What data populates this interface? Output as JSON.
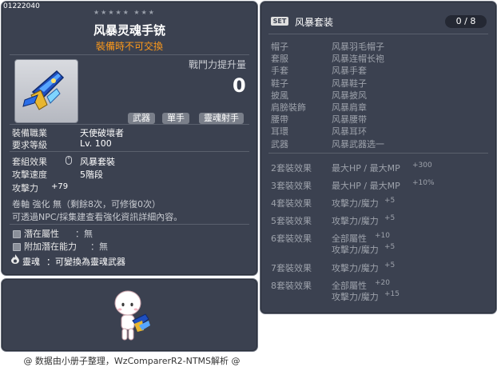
{
  "item": {
    "serial": "01222040",
    "stars_row": "★★★★★  ★★★",
    "name": "风暴灵魂手铳",
    "trade_status": "裝備時不可交換",
    "combat_power_label": "戰鬥力提升量",
    "combat_power_value": "0",
    "tags": [
      "武器",
      "單手",
      "靈魂射手"
    ],
    "stats": [
      {
        "label": "裝備職業",
        "value": "天使破壞者"
      },
      {
        "label": "要求等級",
        "value": "Lv. 100"
      },
      {
        "label": "套組效果",
        "value": "风暴套裝"
      },
      {
        "label": "攻擊速度",
        "value": "5階段"
      },
      {
        "label": "攻擊力",
        "value": "+79"
      }
    ],
    "upgrade_note": "卷軸 強化 無（剩餘8次，可修復0次）",
    "info_note": "可透過NPC/採集建查看強化資訊詳細內容。",
    "potential_label": "潛在屬性",
    "potential_value": "：無",
    "bonus_potential_label": "附加潛在能力",
    "bonus_potential_value": "：無",
    "soul_label": "靈魂",
    "soul_value": "：可變換為靈魂武器"
  },
  "set": {
    "badge": "SET",
    "name": "风暴套装",
    "count": "0 / 8",
    "pieces": [
      {
        "slot": "帽子",
        "name": "风暴羽毛帽子"
      },
      {
        "slot": "套服",
        "name": "风暴连帽长袍"
      },
      {
        "slot": "手套",
        "name": "风暴手套"
      },
      {
        "slot": "鞋子",
        "name": "风暴鞋子"
      },
      {
        "slot": "披風",
        "name": "风暴披风"
      },
      {
        "slot": "肩膀裝飾",
        "name": "风暴肩章"
      },
      {
        "slot": "腰帶",
        "name": "风暴腰带"
      },
      {
        "slot": "耳環",
        "name": "风暴耳环"
      },
      {
        "slot": "武器",
        "name": "风暴武器选一"
      }
    ],
    "effects": [
      {
        "label": "2套裝效果",
        "lines": [
          [
            "最大HP / 最大MP",
            "+300"
          ]
        ]
      },
      {
        "label": "3套裝效果",
        "lines": [
          [
            "最大HP / 最大MP",
            "+10%"
          ]
        ]
      },
      {
        "label": "4套裝效果",
        "lines": [
          [
            "攻擊力/魔力",
            "+5"
          ]
        ]
      },
      {
        "label": "5套裝效果",
        "lines": [
          [
            "攻擊力/魔力",
            "+5"
          ]
        ]
      },
      {
        "label": "6套裝效果",
        "lines": [
          [
            "全部屬性",
            "+10"
          ],
          [
            "攻擊力/魔力",
            "+5"
          ]
        ]
      },
      {
        "label": "7套裝效果",
        "lines": [
          [
            "攻擊力/魔力",
            "+5"
          ]
        ]
      },
      {
        "label": "8套裝效果",
        "lines": [
          [
            "全部屬性",
            "+20"
          ],
          [
            "攻擊力/魔力",
            "+15"
          ]
        ]
      }
    ]
  },
  "footer": "@ 数据由小册子整理，WzComparerR2-NTMS解析 @"
}
